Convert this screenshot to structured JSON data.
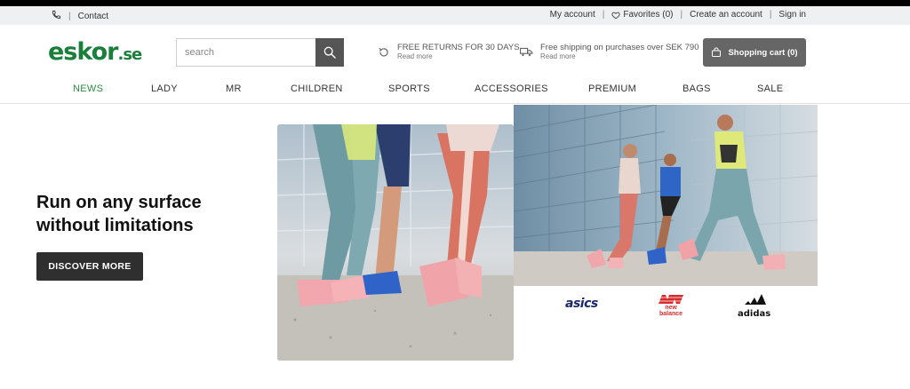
{
  "utility": {
    "contact": "Contact",
    "my_account": "My account",
    "favorites": "Favorites (0)",
    "create_account": "Create an account",
    "sign_in": "Sign in"
  },
  "header": {
    "logo_main": "eskor",
    "logo_tld": ".se",
    "search_placeholder": "search",
    "usp_returns_title": "FREE RETURNS FOR 30 DAYS",
    "usp_returns_sub": "Read more",
    "usp_shipping_title": "Free shipping on purchases over SEK 790",
    "usp_shipping_sub": "Read more",
    "cart_label": "Shopping cart (0)"
  },
  "nav": {
    "items": [
      "NEWS",
      "LADY",
      "MR",
      "CHILDREN",
      "SPORTS",
      "ACCESSORIES",
      "PREMIUM",
      "BAGS",
      "SALE"
    ],
    "active": "NEWS"
  },
  "hero": {
    "title": "Run on any surface without limitations",
    "cta": "DISCOVER MORE"
  },
  "brands": [
    "asics",
    "new balance",
    "adidas"
  ],
  "colors": {
    "brand_green": "#1a7f3a",
    "nav_active": "#2e8b3d",
    "cta_bg": "#2f2f2f",
    "cart_bg": "#666666"
  }
}
